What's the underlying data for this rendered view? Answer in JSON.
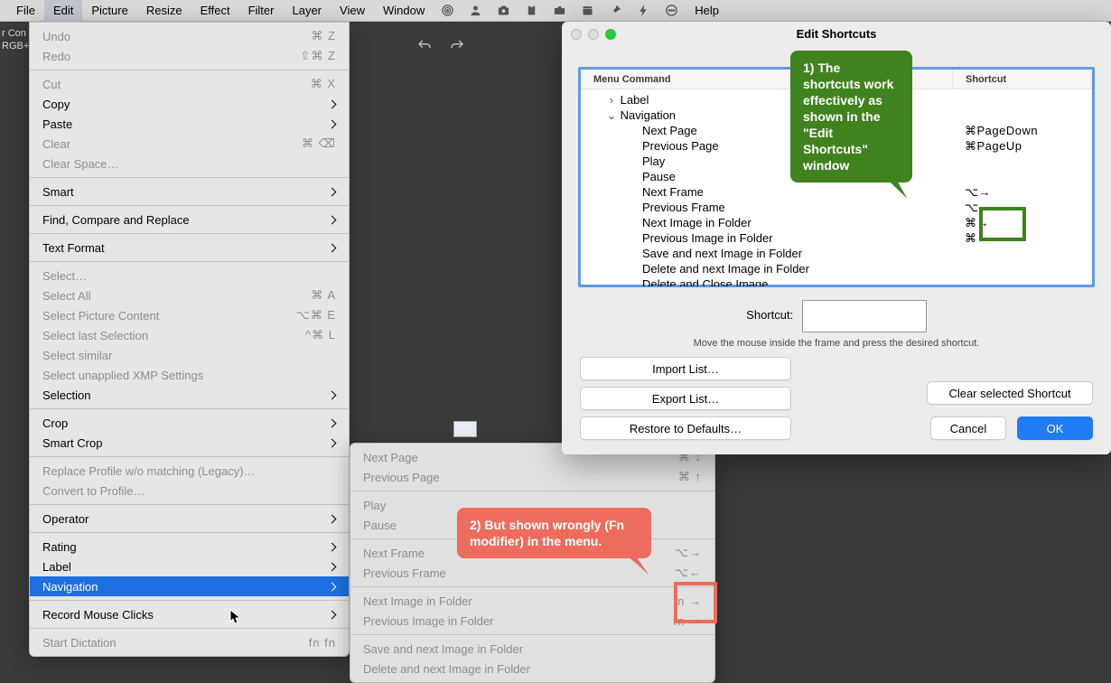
{
  "menubar": {
    "items": [
      "File",
      "Edit",
      "Picture",
      "Resize",
      "Effect",
      "Filter",
      "Layer",
      "View",
      "Window"
    ],
    "help": "Help",
    "active": "Edit"
  },
  "doc": {
    "line1": "r Con",
    "line2": "RGB+A"
  },
  "edit_shortcuts_panel": {
    "title": "Edit Shortcuts",
    "col_cmd": "Menu Command",
    "col_shc": "Shortcut",
    "tree": [
      {
        "label": "Label",
        "depth": 0,
        "disclosure": "›",
        "shortcut": ""
      },
      {
        "label": "Navigation",
        "depth": 0,
        "disclosure": "⌄",
        "shortcut": ""
      },
      {
        "label": "Next Page",
        "depth": 2,
        "shortcut": "⌘PageDown"
      },
      {
        "label": "Previous Page",
        "depth": 2,
        "shortcut": "⌘PageUp"
      },
      {
        "label": "Play",
        "depth": 2,
        "shortcut": ""
      },
      {
        "label": "Pause",
        "depth": 2,
        "shortcut": ""
      },
      {
        "label": "Next Frame",
        "depth": 2,
        "shortcut": "⌥→"
      },
      {
        "label": "Previous Frame",
        "depth": 2,
        "shortcut": "⌥←"
      },
      {
        "label": "Next Image in Folder",
        "depth": 2,
        "shortcut": "⌘→"
      },
      {
        "label": "Previous Image in Folder",
        "depth": 2,
        "shortcut": "⌘←"
      },
      {
        "label": "Save and next Image in Folder",
        "depth": 2,
        "shortcut": ""
      },
      {
        "label": "Delete and next Image in Folder",
        "depth": 2,
        "shortcut": ""
      },
      {
        "label": "Delete and Close Image",
        "depth": 2,
        "shortcut": ""
      }
    ],
    "shortcut_label": "Shortcut:",
    "help_text": "Move the mouse inside the frame and press the desired shortcut.",
    "btn_import": "Import List…",
    "btn_export": "Export List…",
    "btn_restore": "Restore to Defaults…",
    "btn_clear": "Clear selected Shortcut",
    "btn_cancel": "Cancel",
    "btn_ok": "OK"
  },
  "edit_menu": [
    {
      "label": "Undo",
      "shortcut": "⌘ Z",
      "disabled": true
    },
    {
      "label": "Redo",
      "shortcut": "⇧⌘ Z",
      "disabled": true
    },
    {
      "sep": true
    },
    {
      "label": "Cut",
      "shortcut": "⌘ X",
      "disabled": true
    },
    {
      "label": "Copy",
      "submenu": true
    },
    {
      "label": "Paste",
      "submenu": true
    },
    {
      "label": "Clear",
      "shortcut": "⌘ ⌫",
      "disabled": true
    },
    {
      "label": "Clear Space…",
      "disabled": true
    },
    {
      "sep": true
    },
    {
      "label": "Smart",
      "submenu": true
    },
    {
      "sep": true
    },
    {
      "label": "Find, Compare and Replace",
      "submenu": true
    },
    {
      "sep": true
    },
    {
      "label": "Text Format",
      "submenu": true
    },
    {
      "sep": true
    },
    {
      "label": "Select…",
      "disabled": true
    },
    {
      "label": "Select All",
      "shortcut": "⌘ A",
      "disabled": true
    },
    {
      "label": "Select Picture Content",
      "shortcut": "⌥⌘ E",
      "disabled": true
    },
    {
      "label": "Select last Selection",
      "shortcut": "^⌘ L",
      "disabled": true
    },
    {
      "label": "Select similar",
      "disabled": true
    },
    {
      "label": "Select unapplied XMP Settings",
      "disabled": true
    },
    {
      "label": "Selection",
      "submenu": true
    },
    {
      "sep": true
    },
    {
      "label": "Crop",
      "submenu": true
    },
    {
      "label": "Smart Crop",
      "submenu": true
    },
    {
      "sep": true
    },
    {
      "label": "Replace Profile w/o matching (Legacy)…",
      "disabled": true
    },
    {
      "label": "Convert to Profile…",
      "disabled": true
    },
    {
      "sep": true
    },
    {
      "label": "Operator",
      "submenu": true
    },
    {
      "sep": true
    },
    {
      "label": "Rating",
      "submenu": true
    },
    {
      "label": "Label",
      "submenu": true
    },
    {
      "label": "Navigation",
      "submenu": true,
      "highlight": true
    },
    {
      "sep": true
    },
    {
      "label": "Record Mouse Clicks",
      "submenu": true
    },
    {
      "sep": true
    },
    {
      "label": "Start Dictation",
      "shortcut": "fn fn",
      "disabled": true
    }
  ],
  "nav_submenu": [
    {
      "label": "Next Page",
      "shortcut": "⌘ ↓",
      "disabled": true
    },
    {
      "label": "Previous Page",
      "shortcut": "⌘ ↑",
      "disabled": true
    },
    {
      "sep": true
    },
    {
      "label": "Play",
      "disabled": true
    },
    {
      "label": "Pause",
      "disabled": true
    },
    {
      "sep": true
    },
    {
      "label": "Next Frame",
      "shortcut": "⌥→",
      "disabled": true
    },
    {
      "label": "Previous Frame",
      "shortcut": "⌥←",
      "disabled": true
    },
    {
      "sep": true
    },
    {
      "label": "Next Image in Folder",
      "shortcut": "fn →",
      "disabled": true
    },
    {
      "label": "Previous Image in Folder",
      "shortcut": "fn ←",
      "disabled": true
    },
    {
      "sep": true
    },
    {
      "label": "Save and next Image in Folder",
      "disabled": true
    },
    {
      "label": "Delete and next Image in Folder",
      "disabled": true
    }
  ],
  "callouts": {
    "green": "1) The shortcuts work effectively as shown in the \"Edit Shortcuts\" window",
    "red": "2) But shown wrongly (Fn modifier) in the menu."
  }
}
